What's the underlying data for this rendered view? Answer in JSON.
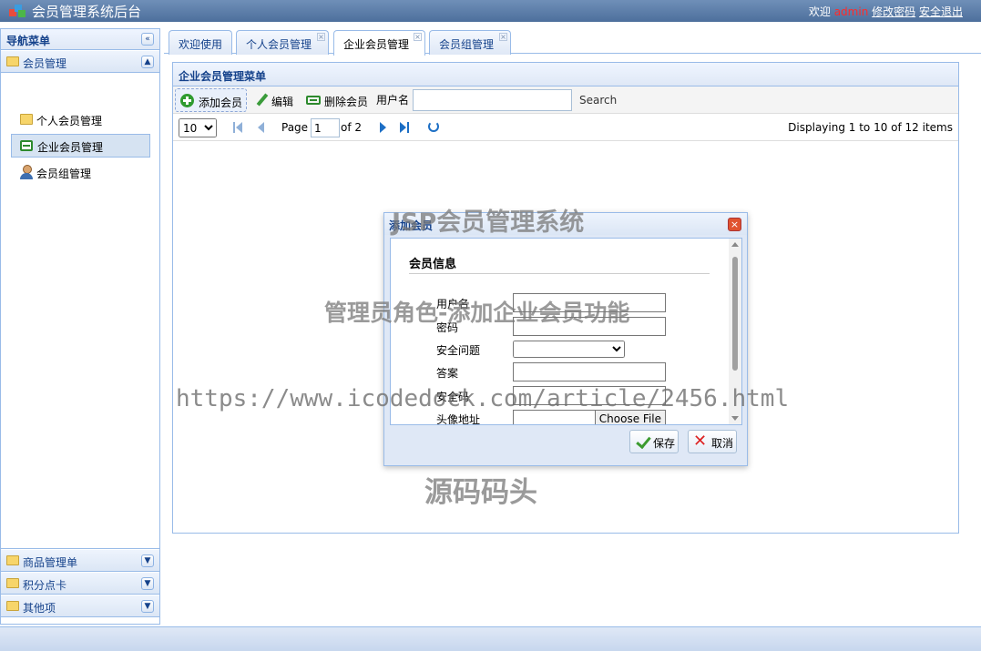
{
  "header": {
    "title": "会员管理系统后台",
    "welcome": "欢迎",
    "username": "admin",
    "change_password": "修改密码",
    "logout": "安全退出"
  },
  "nav": {
    "title": "导航菜单",
    "collapse_icon": "double-chevron-left-icon",
    "sections": [
      {
        "label": "会员管理",
        "expanded": true
      },
      {
        "label": "商品管理单",
        "expanded": false
      },
      {
        "label": "积分点卡",
        "expanded": false
      },
      {
        "label": "其他项",
        "expanded": false
      }
    ],
    "items": [
      {
        "label": "个人会员管理",
        "icon": "folder-icon"
      },
      {
        "label": "企业会员管理",
        "icon": "card-icon",
        "selected": true
      },
      {
        "label": "会员组管理",
        "icon": "user-icon"
      }
    ]
  },
  "tabs": [
    {
      "label": "欢迎使用",
      "closable": false
    },
    {
      "label": "个人会员管理",
      "closable": true
    },
    {
      "label": "企业会员管理",
      "closable": true,
      "selected": true
    },
    {
      "label": "会员组管理",
      "closable": true
    }
  ],
  "panel": {
    "title": "企业会员管理菜单",
    "toolbar": {
      "add": "添加会员",
      "edit": "编辑",
      "delete": "删除会员",
      "username_label": "用户名",
      "username_value": "",
      "search": "Search"
    },
    "pager": {
      "page_size": "10",
      "page_label": "Page",
      "page": "1",
      "of_label": "of 2",
      "info": "Displaying 1 to 10 of 12 items"
    }
  },
  "dialog": {
    "title": "添加会员",
    "section": "会员信息",
    "fields": {
      "username": "用户名",
      "password": "密码",
      "security_question": "安全问题",
      "answer": "答案",
      "security_code": "安全码",
      "avatar": "头像地址"
    },
    "file_button": "Choose File",
    "save": "保存",
    "cancel": "取消"
  },
  "watermarks": {
    "line1": "JSP会员管理系统",
    "line2": "管理员角色-添加企业会员功能",
    "line3": "https://www.icodedock.com/article/2456.html",
    "line4": "源码码头"
  },
  "colors": {
    "header": "#5b7fae",
    "panel_border": "#99bbe8",
    "username_highlight": "#ff2a2a"
  }
}
